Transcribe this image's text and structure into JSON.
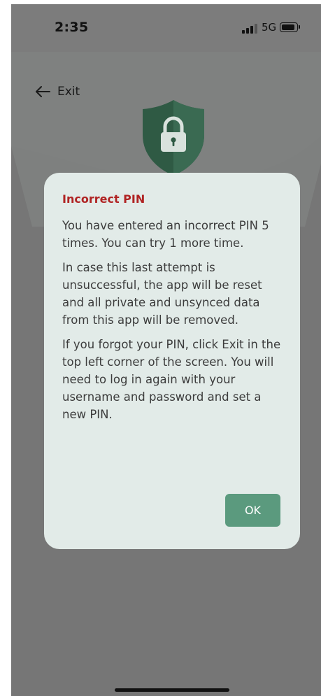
{
  "status_bar": {
    "time": "2:35",
    "network": "5G"
  },
  "nav": {
    "exit_label": "Exit"
  },
  "dialog": {
    "title": "Incorrect PIN",
    "paragraphs": [
      "You have entered an incorrect PIN 5 times. You can try 1 more time.",
      "In case this last attempt is unsuccessful, the app will be reset and all private and unsynced data from this app will be removed.",
      "If you forgot your PIN, click Exit in the top left corner of the screen. You will need to log in again with your username and password and set a new PIN."
    ],
    "ok_label": "OK"
  },
  "colors": {
    "title_red": "#b02323",
    "ok_green": "#5b9a7e",
    "shield_green": "#2f5a44",
    "dialog_bg": "#e2ebe8"
  },
  "icons": {
    "back": "arrow-left-icon",
    "shield": "shield-lock-icon",
    "signal": "signal-bars-icon",
    "battery": "battery-icon"
  }
}
